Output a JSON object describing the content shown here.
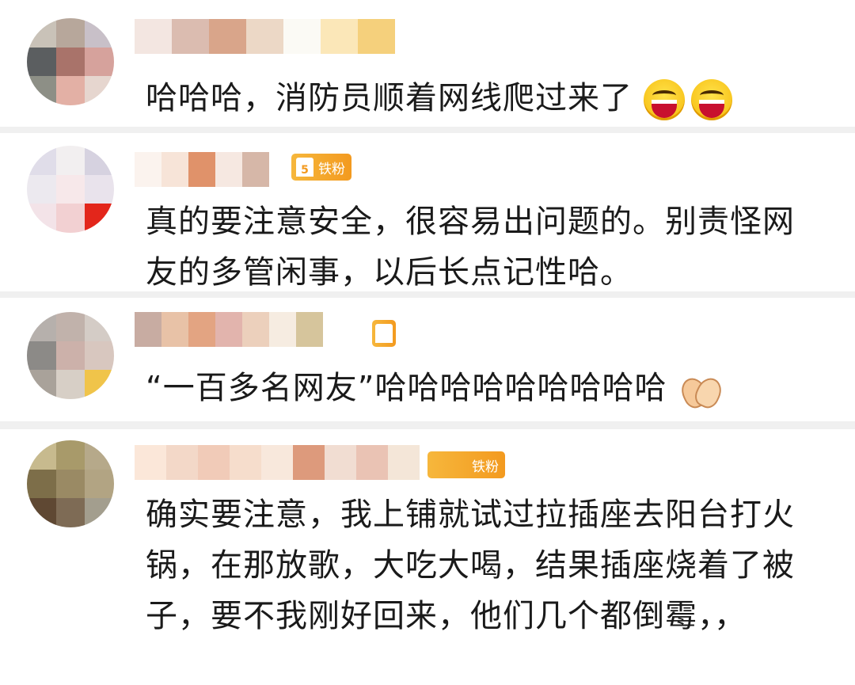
{
  "comments": [
    {
      "text": "哈哈哈，消防员顺着网线爬过来了",
      "emojis": [
        "laugh-emoji",
        "laugh-emoji"
      ],
      "avatar_colors": [
        "#c9c2b8",
        "#b7a79b",
        "#c8c0c8",
        "#5b5e60",
        "#a9736a",
        "#d6a29c",
        "#8d8f86",
        "#e3b0a5",
        "#e6d6cf"
      ],
      "name_colors": [
        "#f3e6e1",
        "#dbbcb0",
        "#d9a58a",
        "#ecd8c6",
        "#fbfaf5",
        "#fbe7b8",
        "#f5d07c"
      ]
    },
    {
      "text": "真的要注意安全，很容易出问题的。别责怪网友的多管闲事，以后长点记性哈。",
      "badge": "铁粉",
      "badge_level": "5",
      "avatar_colors": [
        "#e0dde9",
        "#f2eff0",
        "#d6d2e0",
        "#ece9ef",
        "#f7e8ea",
        "#e9e3ec",
        "#f3e3e8",
        "#f2d0d2",
        "#e3261b"
      ],
      "name_colors": [
        "#fbf3ee",
        "#f7e4d8",
        "#e0926a",
        "#f6e8e1",
        "#d6b7a8"
      ]
    },
    {
      "text": "“一百多名网友”哈哈哈哈哈哈哈哈哈",
      "emojis": [
        "clap-emoji"
      ],
      "avatar_colors": [
        "#b6b0ac",
        "#c1b2ab",
        "#d4ccc6",
        "#8c8a87",
        "#ccb1aa",
        "#d8c7bf",
        "#a9a29a",
        "#d7cfc6",
        "#f0c44a"
      ],
      "name_colors": [
        "#c8aca2",
        "#e8c2a7",
        "#e3a482",
        "#e2b4ad",
        "#ecd0bc",
        "#f6ece1",
        "#d6c59c"
      ]
    },
    {
      "text": "确实要注意，我上铺就试过拉插座去阳台打火锅，在那放歌，大吃大喝，结果插座烧着了被子，要不我刚好回来，他们几个都倒霉，，",
      "badge": "铁粉",
      "avatar_colors": [
        "#c7ba8e",
        "#a89a6a",
        "#b6a98a",
        "#7d6e49",
        "#9a8a64",
        "#b2a483",
        "#5f4833",
        "#7e6b55",
        "#a39e8e"
      ],
      "name_colors": [
        "#fbe7d9",
        "#f3d8c8",
        "#f1cbb8",
        "#f6ddcc",
        "#f8e8dc",
        "#dd9a7c",
        "#f1ddd2",
        "#eac3b4",
        "#f4e6d8"
      ]
    }
  ]
}
